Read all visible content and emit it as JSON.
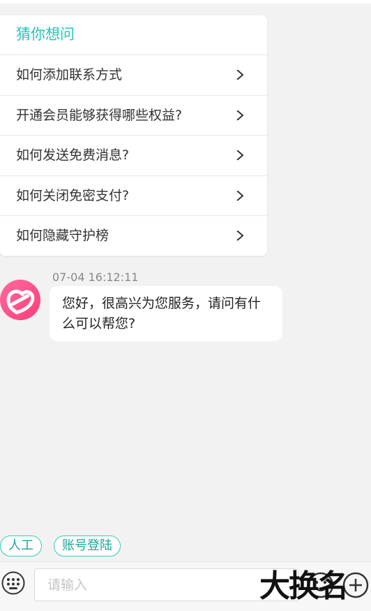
{
  "faq": {
    "title": "猜你想问",
    "items": [
      {
        "label": "如何添加联系方式"
      },
      {
        "label": "开通会员能够获得哪些权益?"
      },
      {
        "label": "如何发送免费消息?"
      },
      {
        "label": "如何关闭免密支付?"
      },
      {
        "label": "如何隐藏守护榜"
      }
    ]
  },
  "message": {
    "timestamp": "07-04 16:12:11",
    "text": "您好，很高兴为您服务，请问有什么可以帮您?"
  },
  "quick_replies": [
    {
      "label": "人工"
    },
    {
      "label": "账号登陆"
    }
  ],
  "input": {
    "placeholder": "请输入"
  },
  "watermark": {
    "text": "大换名"
  },
  "colors": {
    "accent": "#1ec8b8",
    "chip_border": "#35c9ba",
    "background": "#f2f2f2",
    "avatar_pink": "#ff4f8b"
  },
  "icons": {
    "chevron": "chevron-right-icon",
    "keyboard": "keyboard-icon",
    "emoji": "emoji-icon",
    "plus": "plus-icon",
    "avatar": "brand-logo-avatar"
  }
}
